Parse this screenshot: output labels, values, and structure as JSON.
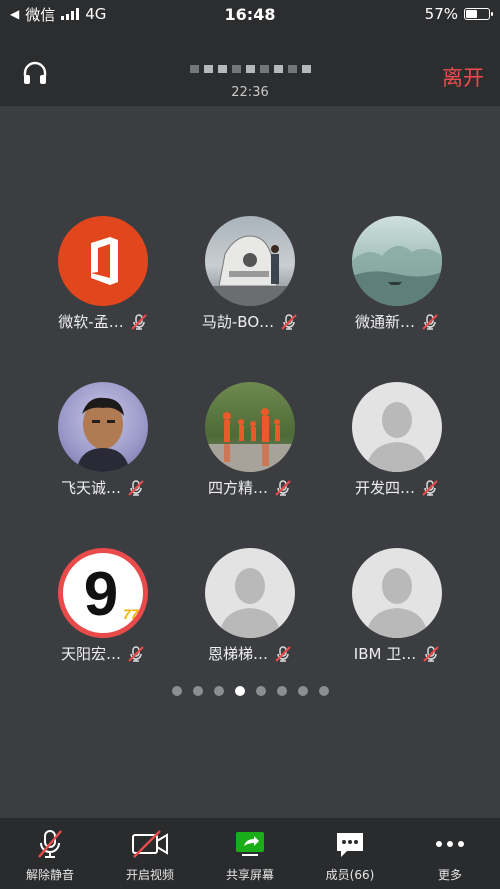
{
  "status_bar": {
    "back_app": "微信",
    "network": "4G",
    "time": "16:48",
    "battery": "57%",
    "battery_level": 0.57
  },
  "header": {
    "timer": "22:36",
    "leave_label": "离开"
  },
  "members": [
    {
      "name": "微软-孟…",
      "avatar": "office-logo"
    },
    {
      "name": "马劼-BO…",
      "avatar": "photo-capsule"
    },
    {
      "name": "微通新…",
      "avatar": "photo-landscape"
    },
    {
      "name": "飞天诚…",
      "avatar": "photo-portrait"
    },
    {
      "name": "四方精…",
      "avatar": "photo-orange-figures"
    },
    {
      "name": "开发四…",
      "avatar": "default-person"
    },
    {
      "name": "天阳宏…",
      "avatar": "number-nine"
    },
    {
      "name": "恩梯梯…",
      "avatar": "default-person"
    },
    {
      "name": "IBM 卫…",
      "avatar": "default-person"
    }
  ],
  "pager": {
    "count": 8,
    "active_index": 3
  },
  "toolbar": {
    "unmute": "解除静音",
    "video": "开启视频",
    "share": "共享屏幕",
    "members": "成员(66)",
    "more": "更多"
  },
  "colors": {
    "accent_red": "#ef4d4d",
    "share_green": "#1aad19",
    "bg": "#3b3d40"
  }
}
